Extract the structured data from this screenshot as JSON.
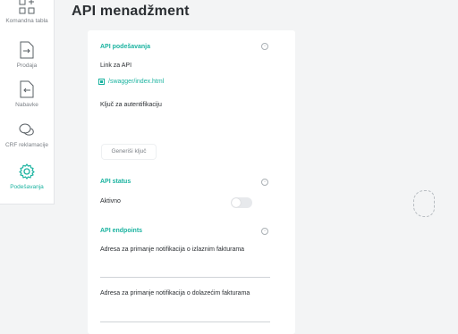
{
  "sidebar": {
    "items": [
      {
        "label": "Komandna tabla",
        "icon": "dashboard-grid-icon"
      },
      {
        "label": "Prodaja",
        "icon": "sales-doc-icon"
      },
      {
        "label": "Nabavke",
        "icon": "purchase-doc-icon"
      },
      {
        "label": "CRF reklamacije",
        "icon": "chat-bubbles-icon"
      },
      {
        "label": "Podešavanja",
        "icon": "gear-icon",
        "active": true
      }
    ]
  },
  "page": {
    "title": "API menadžment"
  },
  "api_settings": {
    "header": "API podešavanja",
    "link_label": "Link za API",
    "link_text": "/swagger/index.html",
    "auth_key_label": "Ključ za autentifikaciju",
    "generate_button": "Generiši ključ"
  },
  "api_status": {
    "header": "API status",
    "active_label": "Aktivno",
    "toggle_on": false
  },
  "api_endpoints": {
    "header": "API endpoints",
    "outgoing_label": "Adresa za primanje notifikacija o izlaznim fakturama",
    "incoming_label": "Adresa za primanje notifikacija o dolazećim fakturama"
  },
  "colors": {
    "accent": "#1bb3a0",
    "panel": "#ffffff",
    "background": "#f3f4f5"
  }
}
